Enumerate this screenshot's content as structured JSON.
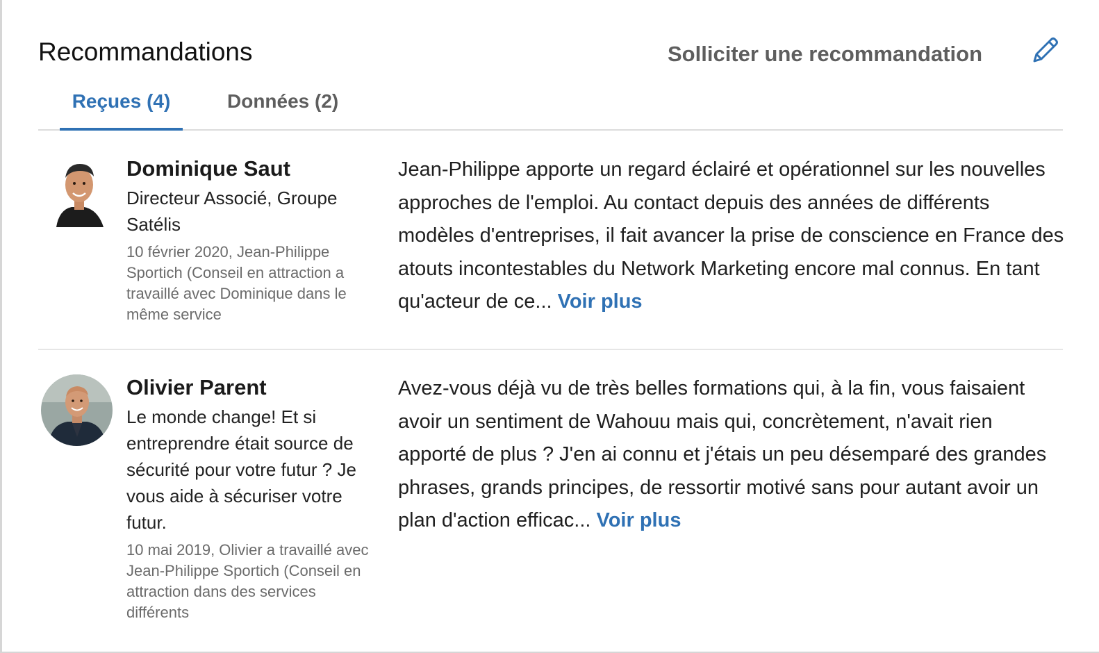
{
  "header": {
    "title": "Recommandations",
    "solicit_label": "Solliciter une recommandation",
    "edit_icon": "pencil-icon"
  },
  "tabs": [
    {
      "label": "Reçues (4)",
      "active": true
    },
    {
      "label": "Données (2)",
      "active": false
    }
  ],
  "recommendations": [
    {
      "name": "Dominique Saut",
      "headline": "Directeur Associé, Groupe Satélis",
      "meta": "10 février 2020, Jean-Philippe Sportich (Conseil en attraction a travaillé avec Dominique dans le même service",
      "text": "Jean-Philippe apporte un regard éclairé et opérationnel sur les nouvelles approches de l'emploi. Au contact depuis des années de différents modèles d'entreprises, il fait avancer la prise de conscience en France des atouts incontestables du Network Marketing encore mal connus. En tant qu'acteur de ce...",
      "more_label": "Voir plus"
    },
    {
      "name": "Olivier Parent",
      "headline": "Le monde change! Et si entreprendre était source de sécurité pour votre futur ? Je vous aide à sécuriser votre futur.",
      "meta": "10 mai 2019, Olivier a travaillé avec Jean-Philippe Sportich (Conseil en attraction dans des services différents",
      "text": "Avez-vous déjà vu de très belles formations qui, à la fin, vous faisaient avoir un sentiment de Wahouu mais qui, concrètement, n'avait rien apporté de plus ? J'en ai connu et j'étais un peu désemparé des grandes phrases, grands principes, de ressortir motivé sans pour autant avoir un plan d'action efficac...",
      "more_label": "Voir plus"
    }
  ],
  "colors": {
    "accent": "#2f71b4",
    "muted": "#5e5e5e",
    "meta": "#6b6b6b"
  }
}
